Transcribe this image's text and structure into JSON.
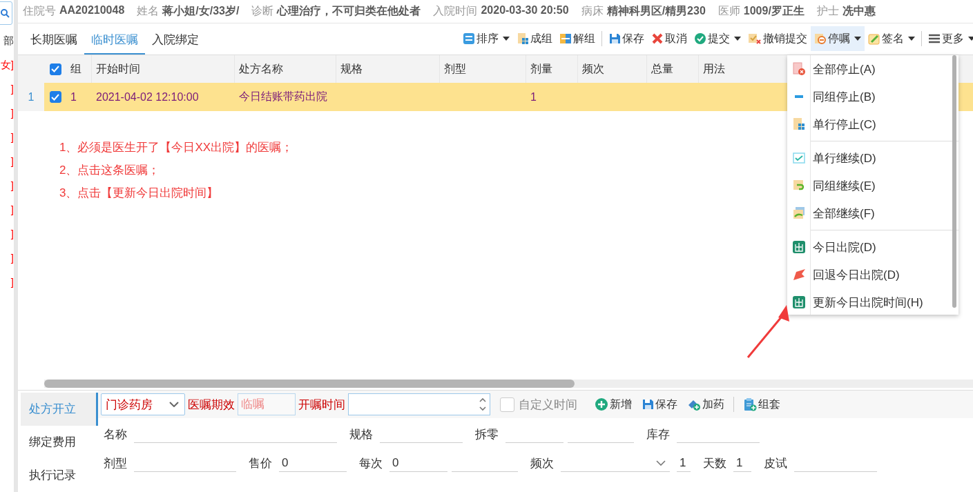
{
  "left_panel": {
    "search_button": true,
    "items": [
      "部",
      "女]",
      "]",
      "]",
      "]",
      "]",
      "]",
      "]",
      "]",
      "]",
      "]"
    ]
  },
  "patient_bar": [
    {
      "label": "住院号",
      "value": "AA20210048"
    },
    {
      "label": "姓名",
      "value": "蒋小姐/女/33岁/"
    },
    {
      "label": "诊断",
      "value": "心理治疗，不可归类在他处者"
    },
    {
      "label": "入院时间",
      "value": "2020-03-30 20:50"
    },
    {
      "label": "病床",
      "value": "精神科男区/精男230"
    },
    {
      "label": "医师",
      "value": "1009/罗正生"
    },
    {
      "label": "护士",
      "value": "冼中惠"
    }
  ],
  "tabs": [
    {
      "label": "长期医嘱",
      "selected": false
    },
    {
      "label": "临时医嘱",
      "selected": true
    },
    {
      "label": "入院绑定",
      "selected": false
    }
  ],
  "toolbar": [
    {
      "label": "排序",
      "kind": "sort",
      "dropdown": true,
      "active": false
    },
    {
      "label": "成组",
      "kind": "group",
      "dropdown": false,
      "active": false
    },
    {
      "label": "解组",
      "kind": "ungroup",
      "dropdown": false,
      "active": false
    },
    {
      "label": "保存",
      "kind": "save",
      "dropdown": false,
      "active": false
    },
    {
      "label": "取消",
      "kind": "cancel",
      "dropdown": false,
      "active": false
    },
    {
      "label": "提交",
      "kind": "submit",
      "dropdown": true,
      "active": false
    },
    {
      "label": "撤销提交",
      "kind": "revoke",
      "dropdown": false,
      "active": false
    },
    {
      "label": "停嘱",
      "kind": "stop",
      "dropdown": true,
      "active": true
    },
    {
      "label": "签名",
      "kind": "sign",
      "dropdown": true,
      "active": false
    },
    {
      "label": "更多",
      "kind": "more",
      "dropdown": true,
      "active": false
    }
  ],
  "table": {
    "columns": [
      "组",
      "开始时间",
      "处方名称",
      "规格",
      "剂型",
      "剂量",
      "频次",
      "总量",
      "用法"
    ],
    "rows": [
      {
        "number": "1",
        "checked": true,
        "selected": true,
        "cells": [
          "1",
          "2021-04-02 12:10:00",
          "今日结账带药出院",
          "",
          "",
          "1",
          "",
          "",
          ""
        ]
      }
    ],
    "header_checked": true
  },
  "notes": [
    "1、必须是医生开了【今日XX出院】的医嘱；",
    "2、点击这条医嘱；",
    "3、点击【更新今日出院时间】"
  ],
  "stop_menu": {
    "groups": [
      [
        {
          "label": "全部停止(A)",
          "kind": "stop-all"
        },
        {
          "label": "同组停止(B)",
          "kind": "minus"
        },
        {
          "label": "单行停止(C)",
          "kind": "grid-doc"
        }
      ],
      [
        {
          "label": "单行继续(D)",
          "kind": "check"
        },
        {
          "label": "同组继续(E)",
          "kind": "undo-doc"
        },
        {
          "label": "全部继续(F)",
          "kind": "redo-doc"
        }
      ],
      [
        {
          "label": "今日出院(D)",
          "kind": "exit"
        },
        {
          "label": "回退今日出院(D)",
          "kind": "back"
        },
        {
          "label": "更新今日出院时间(H)",
          "kind": "exit"
        }
      ]
    ]
  },
  "bottom_tabs": [
    {
      "label": "处方开立",
      "selected": true
    },
    {
      "label": "绑定费用",
      "selected": false
    },
    {
      "label": "执行记录",
      "selected": false
    }
  ],
  "form_bar": {
    "pharmacy": "门诊药房",
    "validity_label": "医嘱期效",
    "validity_value": "临嘱",
    "time_label": "开嘱时间",
    "custom_time": {
      "label": "自定义时间",
      "checked": false
    },
    "buttons": [
      {
        "label": "新增",
        "kind": "add"
      },
      {
        "label": "保存",
        "kind": "save"
      },
      {
        "label": "加药",
        "kind": "drug"
      },
      {
        "label": "组套",
        "kind": "set"
      }
    ]
  },
  "form": {
    "rows": [
      [
        {
          "label": "名称",
          "kind": "wide"
        },
        {
          "label": "规格",
          "kind": "mid"
        },
        {
          "label": "拆零",
          "kind": "pair"
        },
        {
          "label": "库存",
          "kind": "mid"
        }
      ],
      [
        {
          "label": "剂型",
          "kind": "short"
        },
        {
          "label": "售价",
          "value": "0",
          "kind": "short"
        },
        {
          "label": "每次",
          "value": "0",
          "kind": "pair"
        },
        {
          "label": "频次",
          "value": "1",
          "kind": "select"
        },
        {
          "label": "天数",
          "value": "1",
          "kind": "tiny"
        },
        {
          "label": "皮试",
          "kind": "mid"
        }
      ]
    ]
  }
}
